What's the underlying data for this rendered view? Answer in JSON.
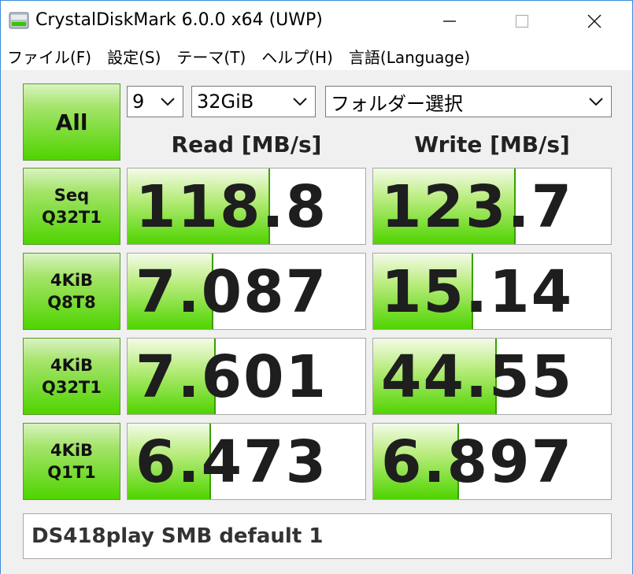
{
  "window": {
    "title": "CrystalDiskMark 6.0.0 x64 (UWP)"
  },
  "menu": [
    "ファイル(F)",
    "設定(S)",
    "テーマ(T)",
    "ヘルプ(H)",
    "言語(Language)"
  ],
  "controls": {
    "all_label": "All",
    "count": "9",
    "size": "32GiB",
    "drive": "フォルダー選択"
  },
  "headers": {
    "read": "Read [MB/s]",
    "write": "Write [MB/s]"
  },
  "tests": [
    {
      "line1": "Seq",
      "line2": "Q32T1",
      "read": "118.8",
      "write": "123.7",
      "read_fill": 0.6,
      "write_fill": 0.6
    },
    {
      "line1": "4KiB",
      "line2": "Q8T8",
      "read": "7.087",
      "write": "15.14",
      "read_fill": 0.36,
      "write_fill": 0.42
    },
    {
      "line1": "4KiB",
      "line2": "Q32T1",
      "read": "7.601",
      "write": "44.55",
      "read_fill": 0.37,
      "write_fill": 0.52
    },
    {
      "line1": "4KiB",
      "line2": "Q1T1",
      "read": "6.473",
      "write": "6.897",
      "read_fill": 0.35,
      "write_fill": 0.36
    }
  ],
  "comment": "DS418play SMB default 1",
  "colors": {
    "accent_green": "#4fd400",
    "window_border": "#3c8dd6"
  },
  "icons": {
    "app": "disk-icon",
    "minimize": "minimize-icon",
    "maximize": "maximize-icon",
    "close": "close-icon",
    "dropdown": "chevron-down-icon"
  }
}
